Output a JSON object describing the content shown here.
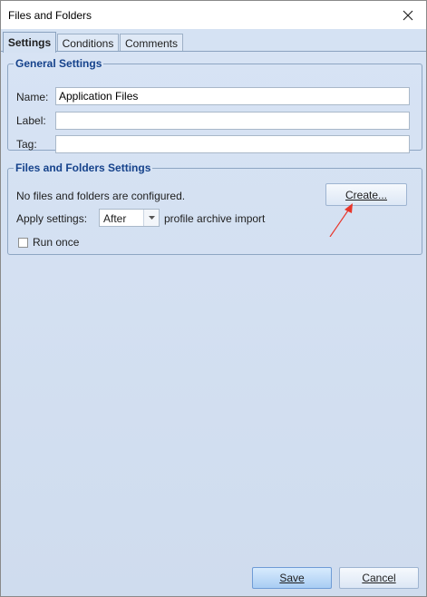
{
  "window": {
    "title": "Files and Folders",
    "close_icon": "close-icon"
  },
  "tabs": [
    {
      "label": "Settings",
      "active": true
    },
    {
      "label": "Conditions",
      "active": false
    },
    {
      "label": "Comments",
      "active": false
    }
  ],
  "general": {
    "legend": "General Settings",
    "name_label": "Name:",
    "name_value": "Application Files",
    "label_label": "Label:",
    "label_value": "",
    "tag_label": "Tag:",
    "tag_value": ""
  },
  "files": {
    "legend": "Files and Folders Settings",
    "status_text": "No files and folders are configured.",
    "create_button": "Create...",
    "apply_label": "Apply settings:",
    "apply_value": "After",
    "apply_suffix": "profile archive import",
    "run_once_label": "Run once",
    "run_once_checked": false
  },
  "footer": {
    "save_label": "Save",
    "cancel_label": "Cancel"
  },
  "colors": {
    "accent": "#15428b",
    "panel": "#d5e2f3",
    "annotation_arrow": "#e8352a"
  }
}
